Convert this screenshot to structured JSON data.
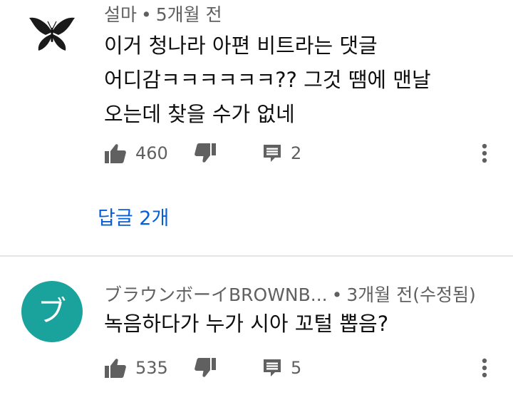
{
  "colors": {
    "background": "#ffffff",
    "meta_text": "#606060",
    "body_text": "#0f0f0f",
    "link": "#065fd4",
    "avatar_letter_bg": "#1aa29c",
    "divider": "#e5e5e5"
  },
  "comments": [
    {
      "author": "설마",
      "separator": "•",
      "time": "5개월 전",
      "avatar": {
        "type": "image",
        "icon": "butterfly-icon"
      },
      "text_lines": [
        "이거 청나라 아편 비트라는 댓글",
        "어디감ㅋㅋㅋㅋㅋㅋ?? 그것 땜에 맨날",
        "오는데 찾을 수가 없네"
      ],
      "likes": "460",
      "replies_count": "2",
      "replies_link": "답글 2개",
      "icons": {
        "like": "thumbs-up-icon",
        "dislike": "thumbs-down-icon",
        "reply": "reply-icon",
        "more": "more-vertical-icon"
      }
    },
    {
      "author": "ブラウンボーイBROWNB...",
      "separator": "•",
      "time": "3개월 전(수정됨)",
      "avatar": {
        "type": "letter",
        "letter": "ブ"
      },
      "text_lines": [
        "녹음하다가 누가 시아 꼬털 뽑음?"
      ],
      "likes": "535",
      "replies_count": "5",
      "icons": {
        "like": "thumbs-up-icon",
        "dislike": "thumbs-down-icon",
        "reply": "reply-icon",
        "more": "more-vertical-icon"
      }
    }
  ]
}
